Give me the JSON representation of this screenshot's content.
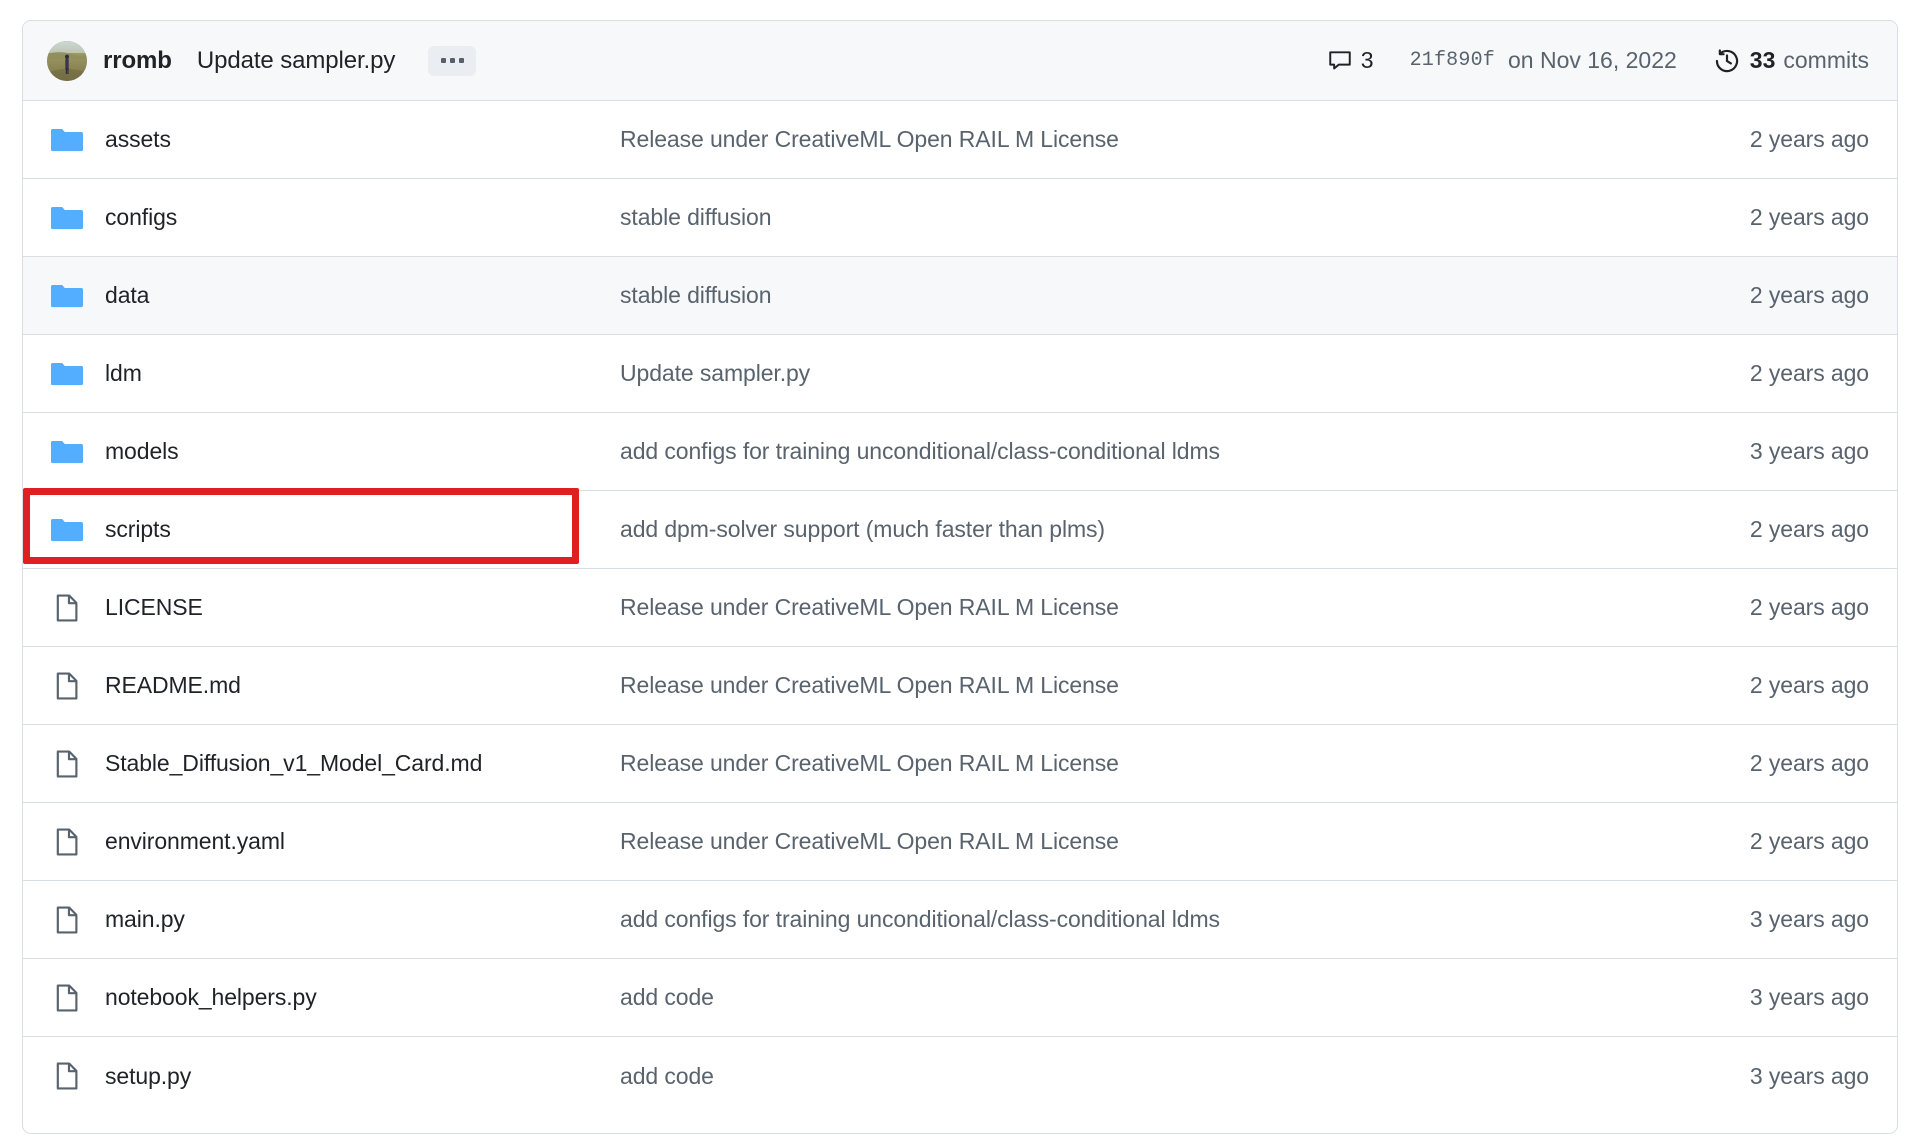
{
  "header": {
    "avatar_alt": "rromb avatar",
    "author": "rromb",
    "commit_message": "Update sampler.py",
    "ellipsis_label": "...",
    "comment_count": "3",
    "commit_sha": "21f890f",
    "commit_date": "on Nov 16, 2022",
    "commits_count": "33",
    "commits_word": "commits",
    "icons": {
      "comment": "comment-icon",
      "history": "history-clock-icon"
    }
  },
  "colors": {
    "folder_blue": "#54aeff",
    "file_gray": "#59636e",
    "text_primary": "#1f2328",
    "text_muted": "#59636e",
    "border": "#d8dee4",
    "header_bg": "#f6f8fa",
    "row_hover_bg": "#f6f8fa",
    "annotation_red": "#e02020"
  },
  "annotation": {
    "target_row_index": 5,
    "shape": "rectangle",
    "color": "#e02020"
  },
  "file_list": {
    "columns": [
      "name",
      "latest commit message",
      "last commit date"
    ],
    "rows": [
      {
        "icon": "folder-icon",
        "type": "folder",
        "name": "assets",
        "message": "Release under CreativeML Open RAIL M License",
        "age": "2 years ago",
        "hovered": false,
        "highlighted": false
      },
      {
        "icon": "folder-icon",
        "type": "folder",
        "name": "configs",
        "message": "stable diffusion",
        "age": "2 years ago",
        "hovered": false,
        "highlighted": false
      },
      {
        "icon": "folder-icon",
        "type": "folder",
        "name": "data",
        "message": "stable diffusion",
        "age": "2 years ago",
        "hovered": true,
        "highlighted": false
      },
      {
        "icon": "folder-icon",
        "type": "folder",
        "name": "ldm",
        "message": "Update sampler.py",
        "age": "2 years ago",
        "hovered": false,
        "highlighted": false
      },
      {
        "icon": "folder-icon",
        "type": "folder",
        "name": "models",
        "message": "add configs for training unconditional/class-conditional ldms",
        "age": "3 years ago",
        "hovered": false,
        "highlighted": false
      },
      {
        "icon": "folder-icon",
        "type": "folder",
        "name": "scripts",
        "message": "add dpm-solver support (much faster than plms)",
        "age": "2 years ago",
        "hovered": false,
        "highlighted": true
      },
      {
        "icon": "file-icon",
        "type": "file",
        "name": "LICENSE",
        "message": "Release under CreativeML Open RAIL M License",
        "age": "2 years ago",
        "hovered": false,
        "highlighted": false
      },
      {
        "icon": "file-icon",
        "type": "file",
        "name": "README.md",
        "message": "Release under CreativeML Open RAIL M License",
        "age": "2 years ago",
        "hovered": false,
        "highlighted": false
      },
      {
        "icon": "file-icon",
        "type": "file",
        "name": "Stable_Diffusion_v1_Model_Card.md",
        "message": "Release under CreativeML Open RAIL M License",
        "age": "2 years ago",
        "hovered": false,
        "highlighted": false
      },
      {
        "icon": "file-icon",
        "type": "file",
        "name": "environment.yaml",
        "message": "Release under CreativeML Open RAIL M License",
        "age": "2 years ago",
        "hovered": false,
        "highlighted": false
      },
      {
        "icon": "file-icon",
        "type": "file",
        "name": "main.py",
        "message": "add configs for training unconditional/class-conditional ldms",
        "age": "3 years ago",
        "hovered": false,
        "highlighted": false
      },
      {
        "icon": "file-icon",
        "type": "file",
        "name": "notebook_helpers.py",
        "message": "add code",
        "age": "3 years ago",
        "hovered": false,
        "highlighted": false
      },
      {
        "icon": "file-icon",
        "type": "file",
        "name": "setup.py",
        "message": "add code",
        "age": "3 years ago",
        "hovered": false,
        "highlighted": false
      }
    ]
  }
}
